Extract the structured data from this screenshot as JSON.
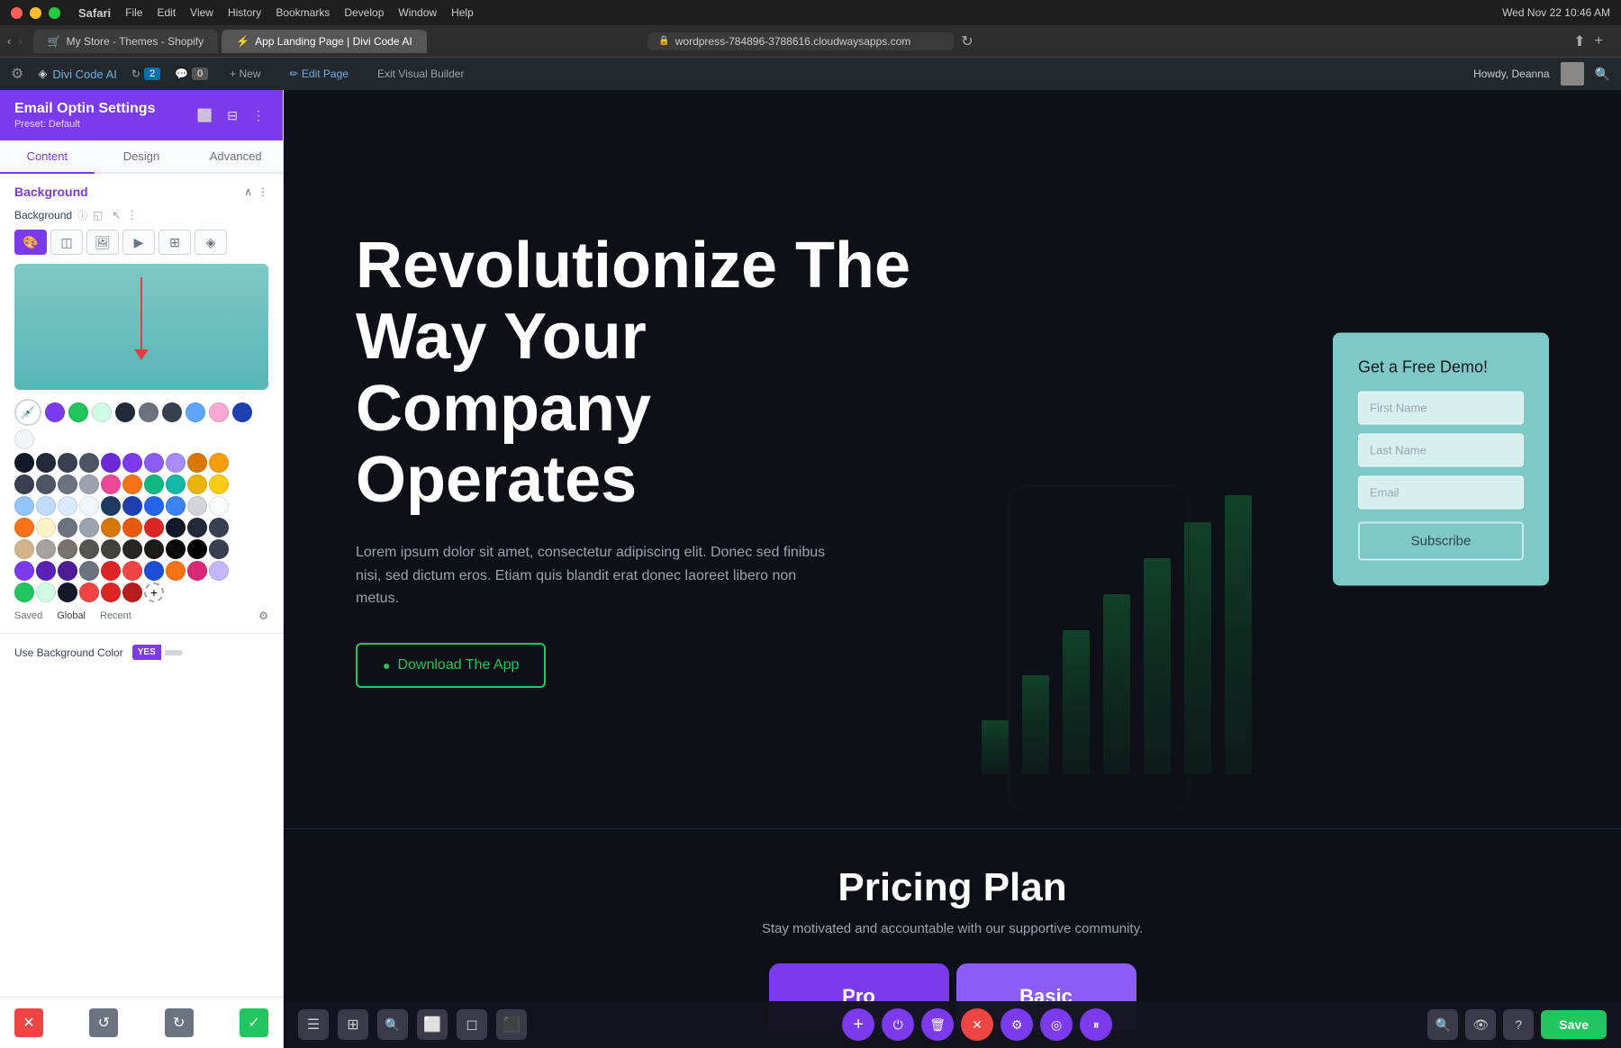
{
  "mac": {
    "time": "Wed Nov 22  10:46 AM",
    "browser": "Safari",
    "menu_items": [
      "Safari",
      "File",
      "Edit",
      "View",
      "History",
      "Bookmarks",
      "Develop",
      "Window",
      "Help"
    ]
  },
  "browser": {
    "url": "wordpress-784896-3788616.cloudwaysapps.com",
    "tabs": [
      {
        "label": "My Store - Themes - Shopify",
        "active": false
      },
      {
        "label": "App Landing Page | Divi Code AI",
        "active": true
      }
    ],
    "refresh_btn": "↻"
  },
  "wordpress": {
    "toolbar_items": [
      "Divi Code AI",
      "2",
      "0",
      "+ New",
      "Edit Page",
      "Exit Visual Builder"
    ],
    "howdy": "Howdy, Deanna"
  },
  "left_panel": {
    "title": "Email Optin Settings",
    "preset": "Preset: Default",
    "tabs": [
      "Content",
      "Design",
      "Advanced"
    ],
    "active_tab": "Content",
    "section_title": "Background",
    "bg_label": "Background",
    "bg_types": [
      "gradient",
      "flat",
      "image",
      "video",
      "pattern",
      "mask"
    ],
    "color_preview_bg": "#7ec8c8",
    "swatches_row1": [
      "#7c3aed",
      "#22c55e",
      "#d1fae5",
      "#1f2937",
      "#374151",
      "#60a5fa",
      "#f9a8d4",
      "#1e40af",
      "#111827"
    ],
    "swatches_row2": [
      "#1f2937",
      "#3730a3",
      "#4338ca",
      "#2563eb",
      "#7c3aed",
      "#6d28d9",
      "#db2777",
      "#059669",
      "#d97706"
    ],
    "swatches_row3": [
      "#6b7280",
      "#7c3aed",
      "#8b5cf6",
      "#ec4899",
      "#f97316",
      "#10b981",
      "#14b8a6",
      "#eab308",
      "#facc15"
    ],
    "saved_tabs": [
      "Saved",
      "Global",
      "Recent"
    ],
    "toggle_label": "Use Background Color",
    "toggle_value": "YES"
  },
  "hero": {
    "title": "Revolutionize The Way Your Company Operates",
    "description": "Lorem ipsum dolor sit amet, consectetur adipiscing elit. Donec sed finibus nisi, sed dictum eros. Etiam quis blandit erat donec laoreet libero non metus.",
    "cta_label": "Download The App",
    "cta_icon": "●"
  },
  "demo_form": {
    "title": "Get a Free Demo!",
    "first_name_placeholder": "First Name",
    "last_name_placeholder": "Last Name",
    "email_placeholder": "Email",
    "subscribe_label": "Subscribe"
  },
  "pricing": {
    "title": "Pricing Plan",
    "description": "Stay motivated and accountable with our supportive community.",
    "cards": [
      {
        "label": "Pro"
      },
      {
        "label": "Basic"
      }
    ]
  },
  "bottom_toolbar": {
    "save_label": "Save"
  },
  "icons": {
    "lock": "🔒",
    "wp_logo": "⚙",
    "add": "+",
    "power": "⏻",
    "trash": "🗑",
    "close": "✕",
    "gear": "⚙",
    "layers": "≡",
    "pause": "⏸",
    "search": "🔍",
    "question": "?",
    "arrow_left": "←",
    "arrow_right": "→",
    "menu": "☰",
    "grid": "⊞",
    "phone": "📱",
    "tablet": "⬜",
    "desktop": "🖥",
    "plus": "+",
    "history": "↺",
    "redo": "↻",
    "check": "✓",
    "x": "✕",
    "settings": "⚙",
    "collapse": "∧",
    "more": "⋮",
    "info": "ⓘ",
    "responsive": "◱",
    "cursor": "↖",
    "ellipsis": "…"
  }
}
